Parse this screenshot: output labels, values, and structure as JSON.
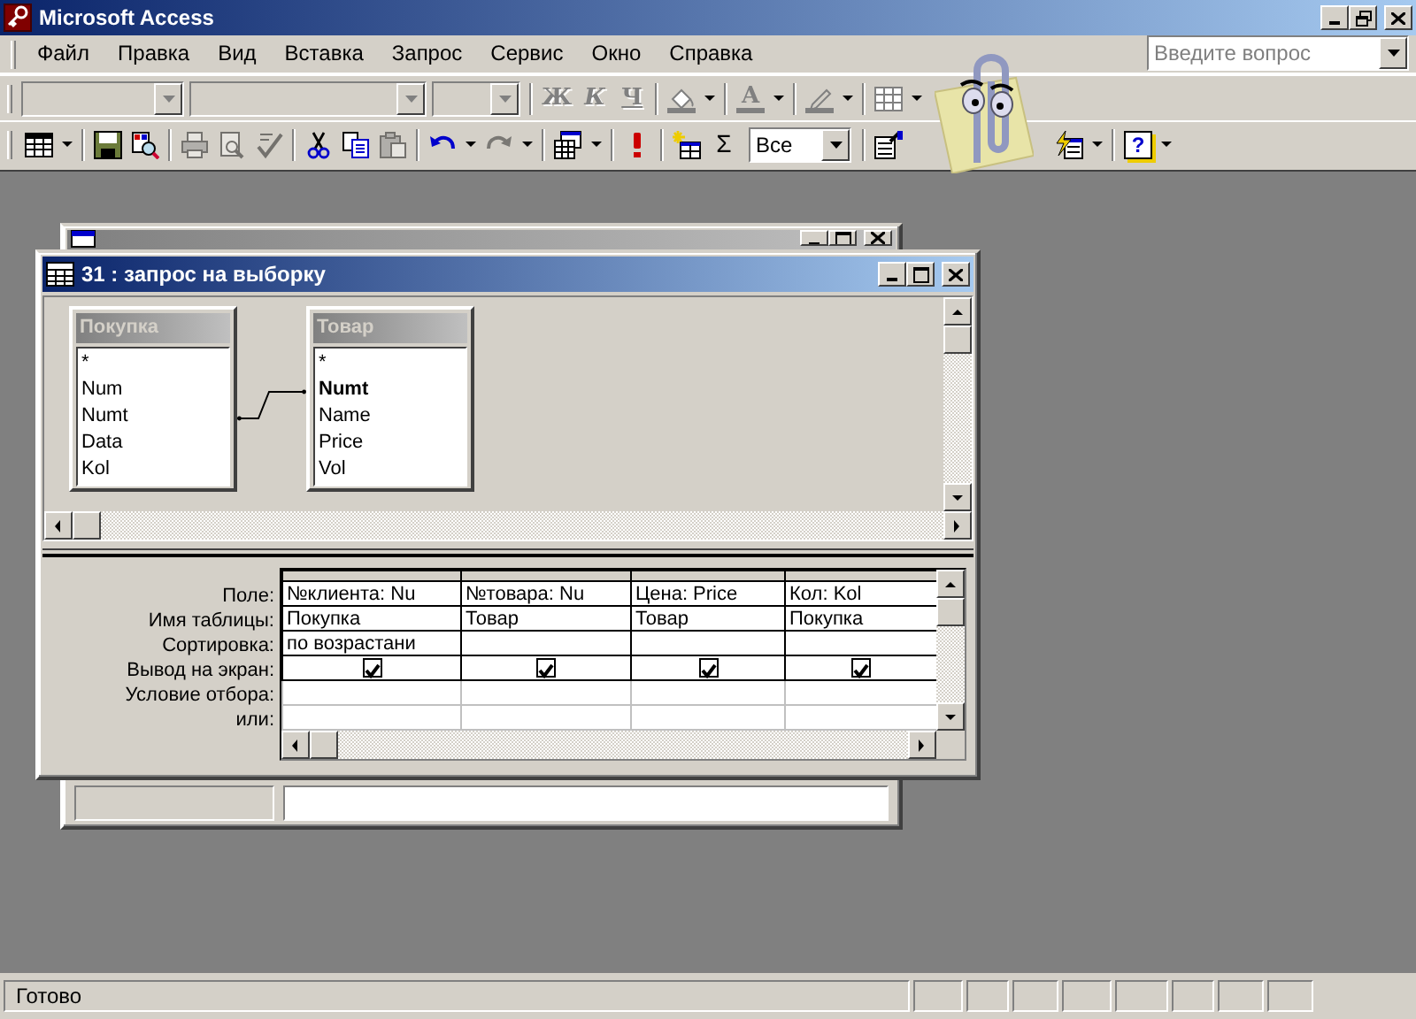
{
  "app": {
    "title": "Microsoft Access"
  },
  "menu": [
    "Файл",
    "Правка",
    "Вид",
    "Вставка",
    "Запрос",
    "Сервис",
    "Окно",
    "Справка"
  ],
  "help_box": {
    "placeholder": "Введите вопрос"
  },
  "formatting_toolbar": {
    "combos": [
      {
        "disabled": true
      },
      {
        "disabled": true
      },
      {
        "disabled": true
      }
    ],
    "style_buttons": [
      {
        "label": "Ж",
        "disabled": true
      },
      {
        "label": "К",
        "disabled": true
      },
      {
        "label": "Ч",
        "disabled": true
      }
    ],
    "font_color_label": "A"
  },
  "query_toolbar": {
    "buttons": [
      {
        "disabled": false
      },
      {
        "disabled": false
      },
      {
        "disabled": false
      },
      {
        "disabled": true
      },
      {
        "disabled": true
      },
      {
        "disabled": true
      },
      {
        "disabled": false
      },
      {
        "disabled": false
      },
      {
        "disabled": true
      },
      {
        "disabled": false
      },
      {
        "disabled": true
      },
      {
        "disabled": false
      },
      {
        "disabled": false
      },
      {
        "disabled": false
      },
      {
        "disabled": false
      },
      {
        "disabled": false
      }
    ],
    "totals_label": "Σ",
    "top_values": "Все",
    "help_label": "?"
  },
  "query_window": {
    "title": "31 : запрос на выборку",
    "tables": [
      {
        "title": "Покупка",
        "fields": [
          {
            "name": "*",
            "key": false
          },
          {
            "name": "Num",
            "key": false
          },
          {
            "name": "Numt",
            "key": false
          },
          {
            "name": "Data",
            "key": false
          },
          {
            "name": "Kol",
            "key": false
          }
        ]
      },
      {
        "title": "Товар",
        "fields": [
          {
            "name": "*",
            "key": false
          },
          {
            "name": "Numt",
            "key": true
          },
          {
            "name": "Name",
            "key": false
          },
          {
            "name": "Price",
            "key": false
          },
          {
            "name": "Vol",
            "key": false
          }
        ]
      }
    ],
    "grid": {
      "row_labels": [
        "Поле:",
        "Имя таблицы:",
        "Сортировка:",
        "Вывод на экран:",
        "Условие отбора:",
        "или:"
      ],
      "columns": [
        {
          "field": "№клиента: Nu",
          "table": "Покупка",
          "sort": "по возрастани",
          "show": true
        },
        {
          "field": "№товара: Nu",
          "table": "Товар",
          "show": true
        },
        {
          "field": "Цена: Price",
          "table": "Товар",
          "show": true
        },
        {
          "field": "Кол: Kol",
          "table": "Покупка",
          "show": true
        }
      ]
    }
  },
  "status_bar": {
    "text": "Готово"
  }
}
